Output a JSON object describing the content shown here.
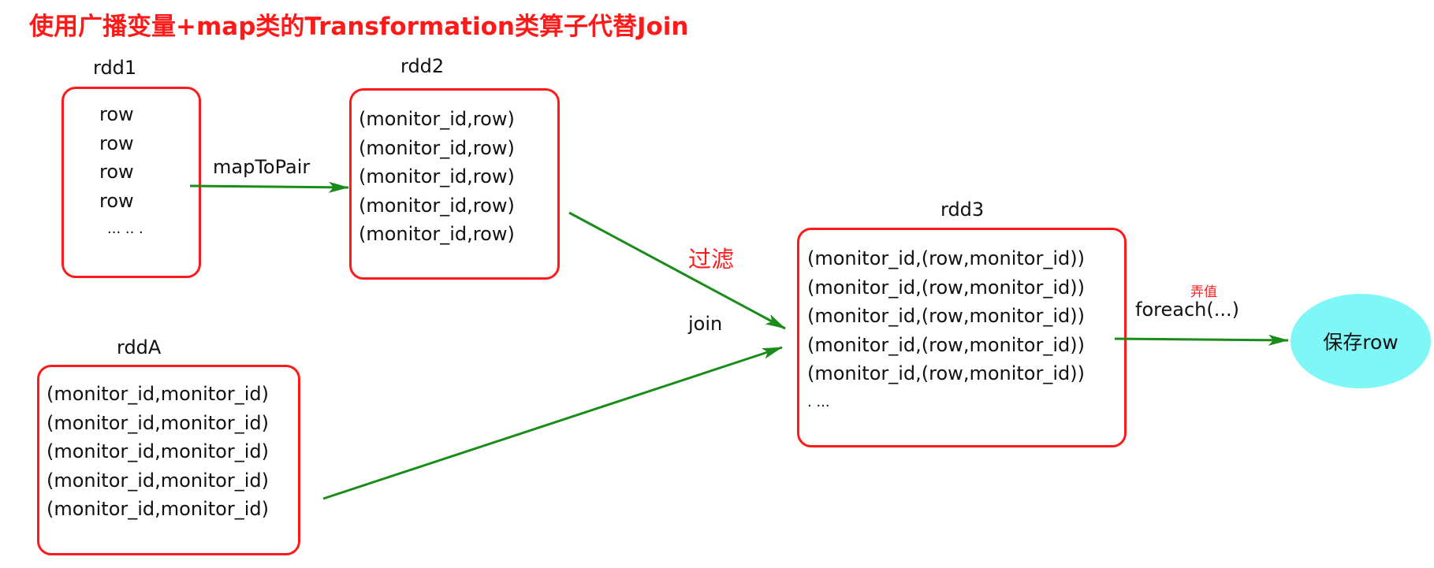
{
  "title": "使用广播变量+map类的Transformation类算子代替Join",
  "nodes": {
    "rdd1": {
      "label": "rdd1",
      "rows": [
        "row",
        "row",
        "row",
        "row",
        "... .. ."
      ]
    },
    "rdd2": {
      "label": "rdd2",
      "rows": [
        "(monitor_id,row)",
        "(monitor_id,row)",
        "(monitor_id,row)",
        "(monitor_id,row)",
        "(monitor_id,row)"
      ]
    },
    "rddA": {
      "label": "rddA",
      "rows": [
        "(monitor_id,monitor_id)",
        "(monitor_id,monitor_id)",
        "(monitor_id,monitor_id)",
        "(monitor_id,monitor_id)",
        "(monitor_id,monitor_id)"
      ]
    },
    "rdd3": {
      "label": "rdd3",
      "rows": [
        "(monitor_id,(row,monitor_id))",
        "(monitor_id,(row,monitor_id))",
        "(monitor_id,(row,monitor_id))",
        "(monitor_id,(row,monitor_id))",
        "(monitor_id,(row,monitor_id))",
        ". ..."
      ]
    },
    "save": {
      "label": "保存row"
    }
  },
  "edges": {
    "map_to_pair": "mapToPair",
    "filter": "过滤",
    "join": "join",
    "foreach": "foreach(...)",
    "foreach_note": "弄值"
  },
  "colors": {
    "title": "#ff1a1a",
    "box_border": "#ff1a1a",
    "arrow": "#1a8c1a",
    "save_fill": "#7ff7f7"
  }
}
